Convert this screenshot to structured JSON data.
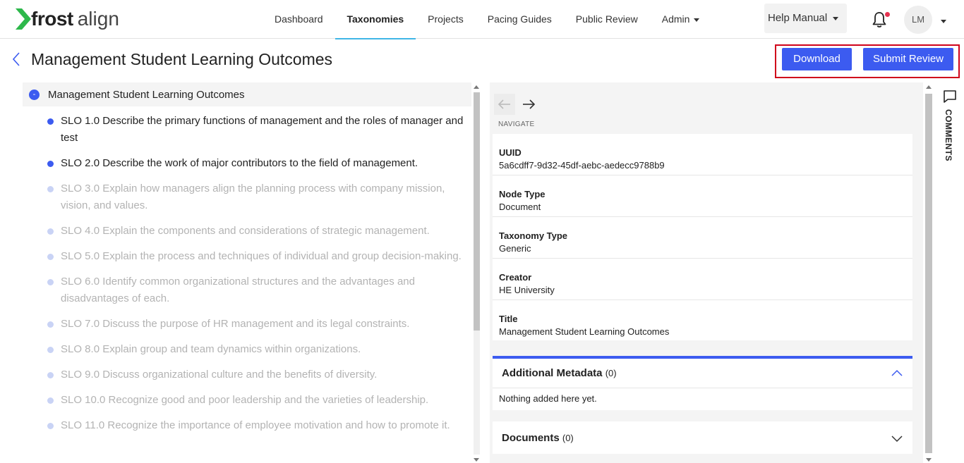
{
  "app": {
    "logo_frost": "frost",
    "logo_align": "align"
  },
  "nav": {
    "items": [
      {
        "label": "Dashboard",
        "active": false
      },
      {
        "label": "Taxonomies",
        "active": true
      },
      {
        "label": "Projects",
        "active": false
      },
      {
        "label": "Pacing Guides",
        "active": false
      },
      {
        "label": "Public Review",
        "active": false
      },
      {
        "label": "Admin",
        "active": false,
        "dropdown": true
      }
    ],
    "help_label": "Help Manual",
    "avatar_initials": "LM"
  },
  "header": {
    "title": "Management Student Learning Outcomes",
    "download_label": "Download",
    "submit_label": "Submit Review"
  },
  "tree": {
    "root_toggle": "-",
    "root_label": "Management Student Learning Outcomes",
    "items": [
      {
        "text": "SLO 1.0 Describe the primary functions of management and the roles of manager and test",
        "state": "on"
      },
      {
        "text": "SLO 2.0 Describe the work of major contributors to the field of management.",
        "state": "on"
      },
      {
        "text": "SLO 3.0 Explain how managers align the planning process with company mission, vision, and values.",
        "state": "off"
      },
      {
        "text": "SLO 4.0 Explain the components and considerations of strategic management.",
        "state": "off"
      },
      {
        "text": "SLO 5.0 Explain the process and techniques of individual and group decision-making.",
        "state": "off"
      },
      {
        "text": "SLO 6.0 Identify common organizational structures and the advantages and disadvantages of each.",
        "state": "off"
      },
      {
        "text": "SLO 7.0 Discuss the purpose of HR management and its legal constraints.",
        "state": "off"
      },
      {
        "text": "SLO 8.0 Explain group and team dynamics within organizations.",
        "state": "off"
      },
      {
        "text": "SLO 9.0 Discuss organizational culture and the benefits of diversity.",
        "state": "off"
      },
      {
        "text": "SLO 10.0 Recognize good and poor leadership and the varieties of leadership.",
        "state": "off"
      },
      {
        "text": "SLO 11.0 Recognize the importance of employee motivation and how to promote it.",
        "state": "off"
      }
    ]
  },
  "details": {
    "navigate_label": "NAVIGATE",
    "fields": [
      {
        "label": "UUID",
        "value": "5a6cdff7-9d32-45df-aebc-aedecc9788b9"
      },
      {
        "label": "Node Type",
        "value": "Document"
      },
      {
        "label": "Taxonomy Type",
        "value": "Generic"
      },
      {
        "label": "Creator",
        "value": "HE University"
      },
      {
        "label": "Title",
        "value": "Management Student Learning Outcomes"
      }
    ],
    "additional_metadata": {
      "title": "Additional Metadata",
      "count": "(0)",
      "empty_text": "Nothing added here yet."
    },
    "documents": {
      "title": "Documents",
      "count": "(0)"
    }
  },
  "comments": {
    "label": "COMMENTS"
  },
  "colors": {
    "accent": "#3c5bf0",
    "active_tab_underline": "#3fb6e6",
    "highlight_box": "#d0021b",
    "notification_dot": "#e53350"
  }
}
